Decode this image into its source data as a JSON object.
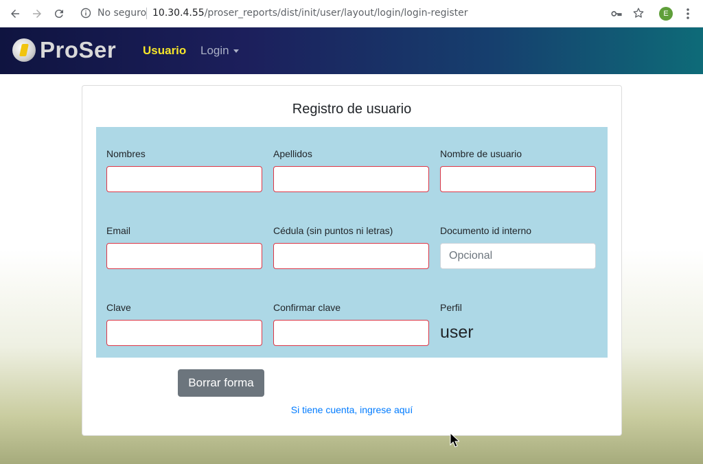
{
  "browser": {
    "security_label": "No seguro",
    "url_host": "10.30.4.55",
    "url_path": "/proser_reports/dist/init/user/layout/login/login-register",
    "profile_initial": "E"
  },
  "navbar": {
    "brand": "ProSer",
    "items": [
      {
        "label": "Usuario",
        "active": true
      },
      {
        "label": "Login",
        "dropdown": true
      }
    ]
  },
  "form": {
    "title": "Registro de usuario",
    "fields": {
      "nombres": {
        "label": "Nombres",
        "value": ""
      },
      "apellidos": {
        "label": "Apellidos",
        "value": ""
      },
      "usuario": {
        "label": "Nombre de usuario",
        "value": ""
      },
      "email": {
        "label": "Email",
        "value": ""
      },
      "cedula": {
        "label": "Cédula (sin puntos ni letras)",
        "value": ""
      },
      "documento": {
        "label": "Documento id interno",
        "value": "",
        "placeholder": "Opcional"
      },
      "clave": {
        "label": "Clave",
        "value": ""
      },
      "confirmar": {
        "label": "Confirmar clave",
        "value": ""
      },
      "perfil": {
        "label": "Perfil",
        "value": "user"
      }
    },
    "reset_button": "Borrar forma",
    "login_link": "Si tiene cuenta, ingrese aquí"
  },
  "colors": {
    "panel_bg": "#add8e6",
    "invalid_border": "#dc3545",
    "nav_active": "#f5e52a",
    "link": "#007bff",
    "button_secondary": "#6c757d"
  }
}
